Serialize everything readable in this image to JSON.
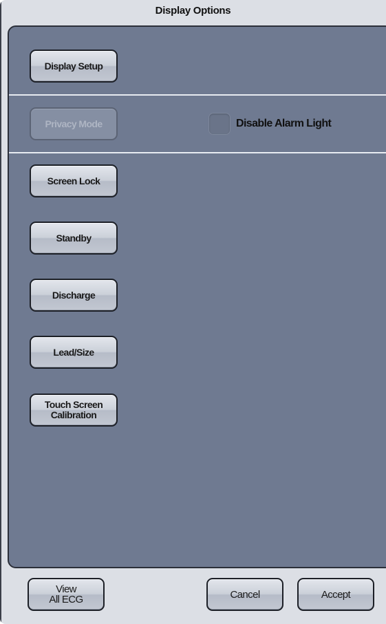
{
  "window": {
    "title": "Display Options"
  },
  "buttons": {
    "display_setup": "Display Setup",
    "privacy_mode": "Privacy Mode",
    "screen_lock": "Screen Lock",
    "standby": "Standby",
    "discharge": "Discharge",
    "lead_size": "Lead/Size",
    "touch_screen_calibration": "Touch Screen\nCalibration"
  },
  "options": {
    "disable_alarm_light": {
      "label": "Disable Alarm Light",
      "checked": false
    }
  },
  "footer": {
    "view_all_ecg": "View\nAll ECG",
    "cancel": "Cancel",
    "accept": "Accept"
  },
  "colors": {
    "panel": "#6f7a91",
    "frame": "#dcdfe5",
    "button_disabled": "#858fa3"
  }
}
